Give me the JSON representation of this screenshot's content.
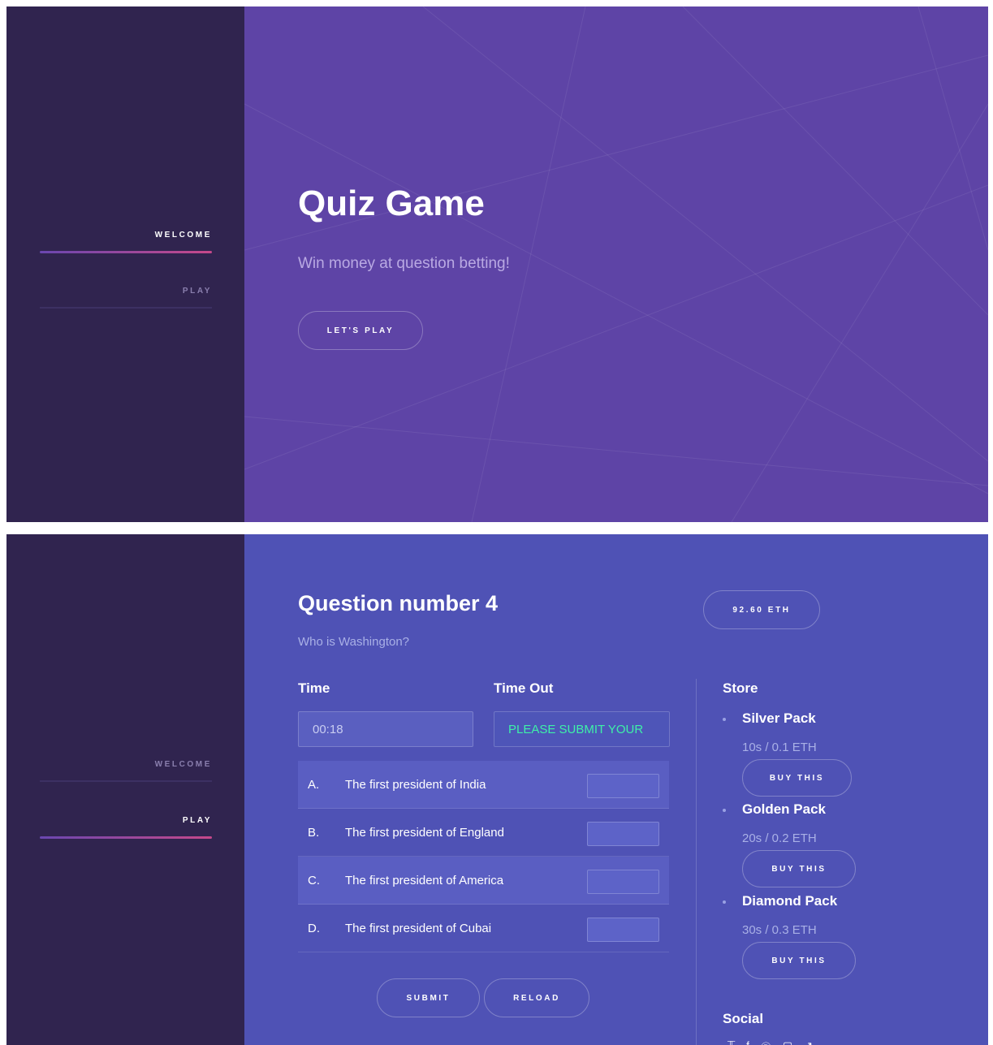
{
  "sidebar": {
    "items": [
      {
        "label": "WELCOME"
      },
      {
        "label": "PLAY"
      }
    ]
  },
  "hero": {
    "title": "Quiz Game",
    "subtitle": "Win money at question betting!",
    "cta_label": "LET'S PLAY"
  },
  "game": {
    "title": "Question number 4",
    "question": "Who is Washington?",
    "balance": "92.60 ETH",
    "time_label": "Time",
    "time_value": "00:18",
    "timeout_label": "Time Out",
    "timeout_value": "PLEASE SUBMIT YOUR",
    "answers": [
      {
        "letter": "A.",
        "text": "The first president of India"
      },
      {
        "letter": "B.",
        "text": "The first president of England"
      },
      {
        "letter": "C.",
        "text": "The first president of America"
      },
      {
        "letter": "D.",
        "text": "The first president of Cubai"
      }
    ],
    "submit_label": "SUBMIT",
    "reload_label": "RELOAD"
  },
  "store": {
    "title": "Store",
    "packs": [
      {
        "name": "Silver Pack",
        "price": "10s / 0.1 ETH",
        "button": "BUY THIS"
      },
      {
        "name": "Golden Pack",
        "price": "20s / 0.2 ETH",
        "button": "BUY THIS"
      },
      {
        "name": "Diamond Pack",
        "price": "30s / 0.3 ETH",
        "button": "BUY THIS"
      }
    ]
  },
  "social": {
    "title": "Social",
    "icons": [
      "twitter-icon",
      "facebook-icon",
      "pinterest-icon",
      "instagram-icon",
      "link-icon"
    ]
  },
  "colors": {
    "sidebar_bg": "#30244f",
    "hero_bg": "#5e44a6",
    "game_bg": "#4f52b5",
    "accent_green": "#3ef0a8",
    "underline_start": "#6a47b0",
    "underline_end": "#c6488a"
  }
}
